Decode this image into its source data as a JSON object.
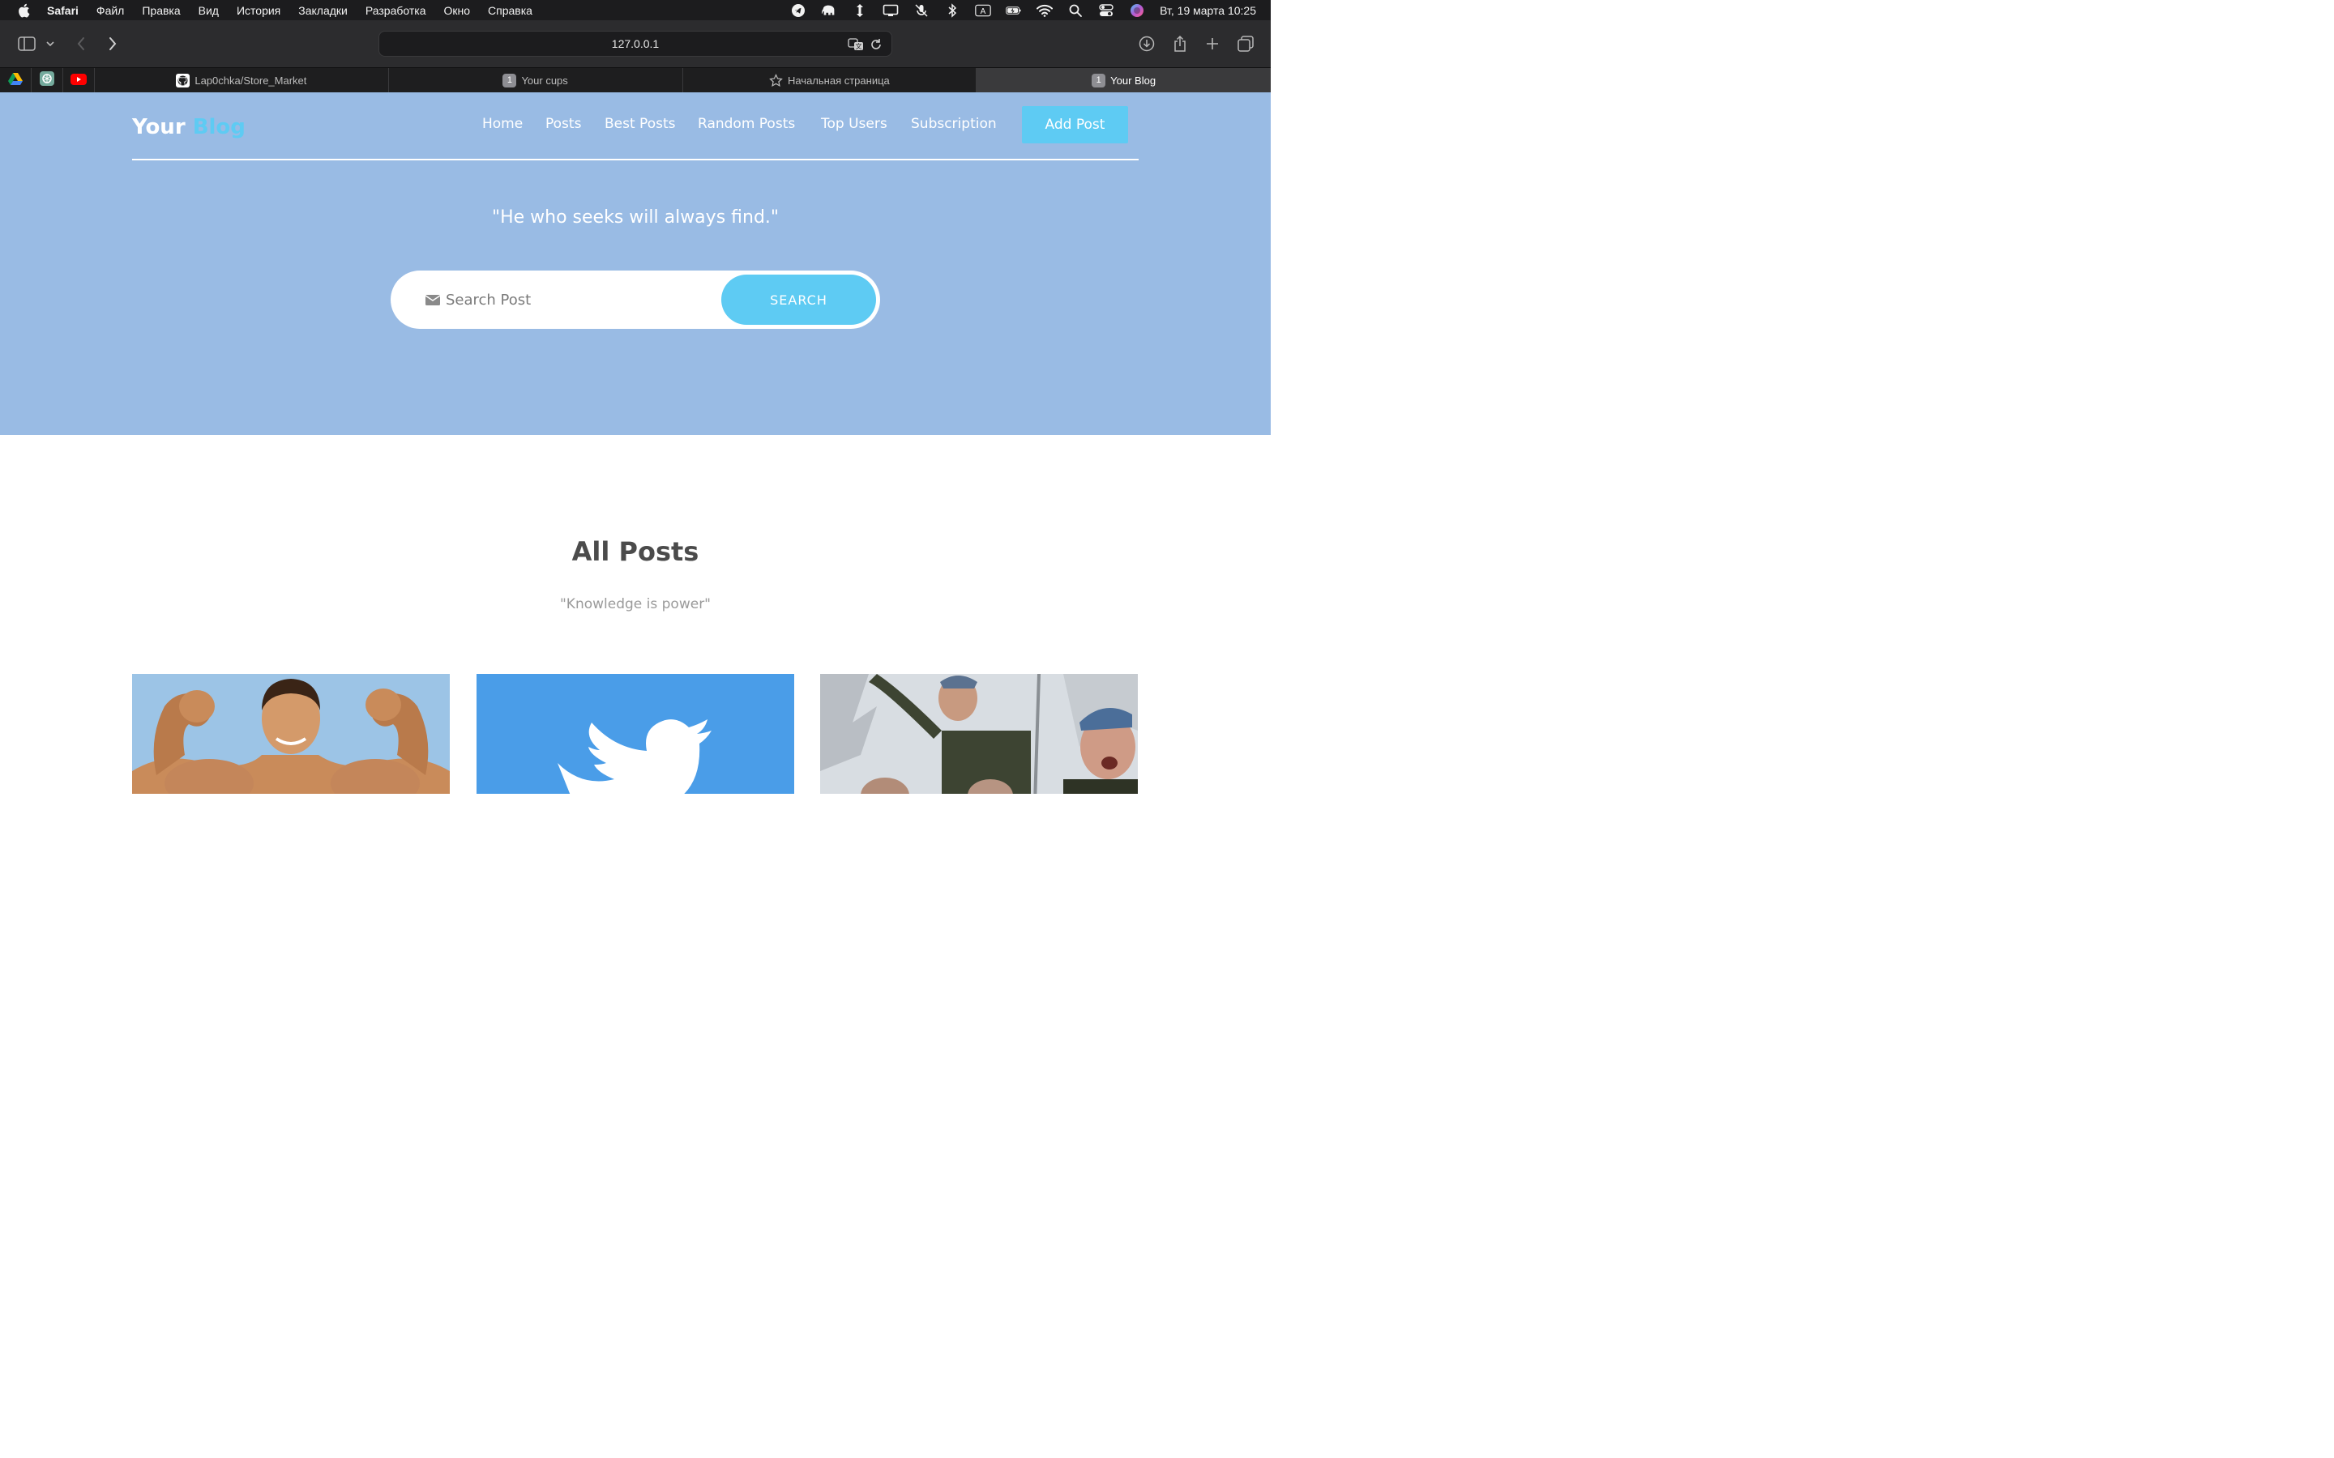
{
  "menubar": {
    "app_name": "Safari",
    "items": [
      "Файл",
      "Правка",
      "Вид",
      "История",
      "Закладки",
      "Разработка",
      "Окно",
      "Справка"
    ],
    "clock": "Вт, 19 марта  10:25",
    "keyboard_layout": "A"
  },
  "browser": {
    "url": "127.0.0.1",
    "tabs": [
      {
        "label": "Lap0chka/Store_Market",
        "icon": "github-icon"
      },
      {
        "label": "Your cups",
        "badge": "1"
      },
      {
        "label": "Начальная страница",
        "icon": "star-icon"
      },
      {
        "label": "Your Blog",
        "badge": "1",
        "active": true
      }
    ],
    "pinned_tabs": [
      "google-drive-icon",
      "chatgpt-icon",
      "youtube-icon"
    ]
  },
  "site": {
    "logo_main": "Your",
    "logo_accent": "Blog",
    "nav": [
      "Home",
      "Posts",
      "Best Posts",
      "Random Posts",
      "Top Users",
      "Subscription"
    ],
    "add_post_label": "Add Post",
    "hero_quote": "\"He who seeks will always find.\"",
    "search": {
      "placeholder": "Search Post",
      "button_label": "SEARCH"
    },
    "section_title": "All Posts",
    "section_subtitle": "\"Knowledge is power\"",
    "colors": {
      "hero_bg": "#99bbe4",
      "accent": "#5ecbf3",
      "twitter_blue": "#4a9de8"
    }
  }
}
